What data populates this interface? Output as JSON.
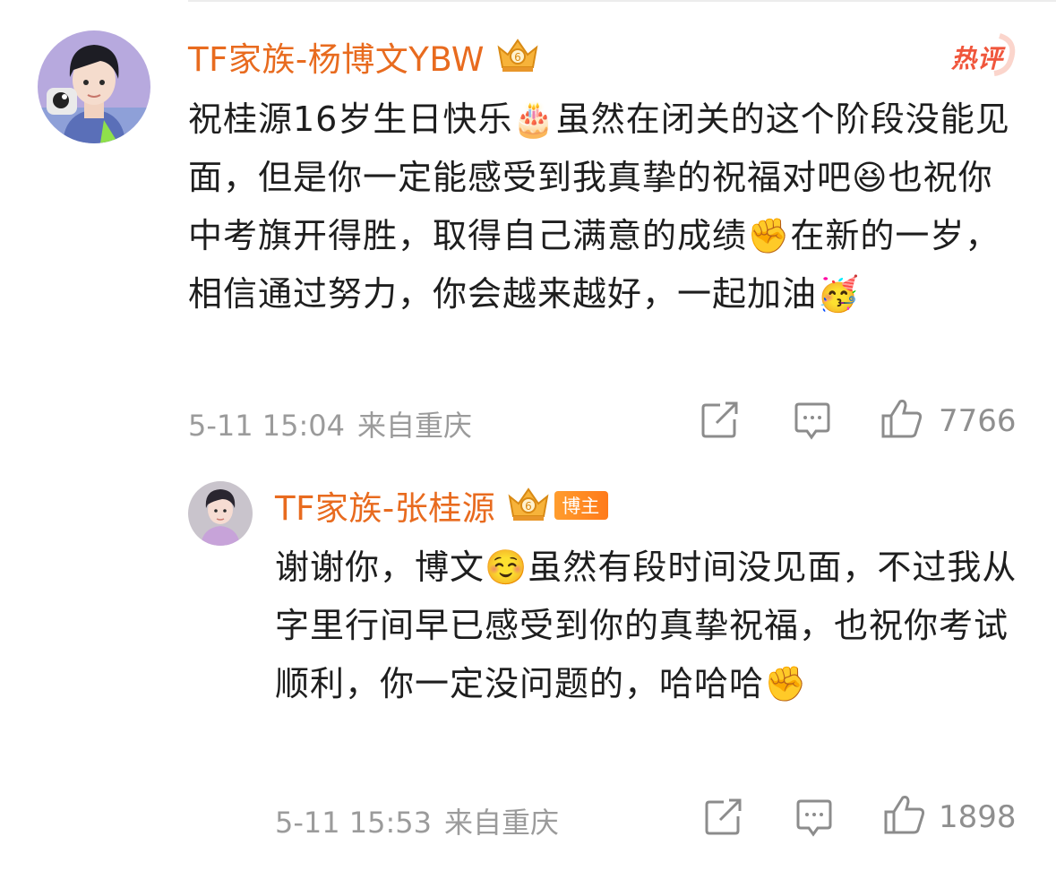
{
  "comment": {
    "username": "TF家族-杨博文YBW",
    "hot_label": "热评",
    "text_parts": [
      "祝桂源16岁生日快乐",
      "🎂",
      "虽然在闭关的这个阶段没能见面，但是你一定能感受到我真挚的祝福对吧",
      "😆",
      "也祝你中考旗开得胜，取得自己满意的成绩",
      "✊",
      "在新的一岁，相信通过努力，你会越来越好，一起加油",
      "🥳"
    ],
    "timestamp": "5-11 15:04",
    "location": "来自重庆",
    "likes": "7766",
    "icons": {
      "repost": "repost-icon",
      "reply": "comment-icon",
      "like": "thumbs-up-icon",
      "badge": "crown-badge-icon"
    }
  },
  "reply": {
    "username": "TF家族-张桂源",
    "owner_badge": "博主",
    "text_parts": [
      "谢谢你，博文",
      "☺️",
      "虽然有段时间没见面，不过我从字里行间早已感受到你的真挚祝福，也祝你考试顺利，你一定没问题的，哈哈哈",
      "✊"
    ],
    "timestamp": "5-11 15:53",
    "location": "来自重庆",
    "likes": "1898"
  },
  "colors": {
    "username": "#e86b1f",
    "hot": "#f0563c",
    "meta": "#9b9b9b",
    "text": "#1e1e1e"
  }
}
